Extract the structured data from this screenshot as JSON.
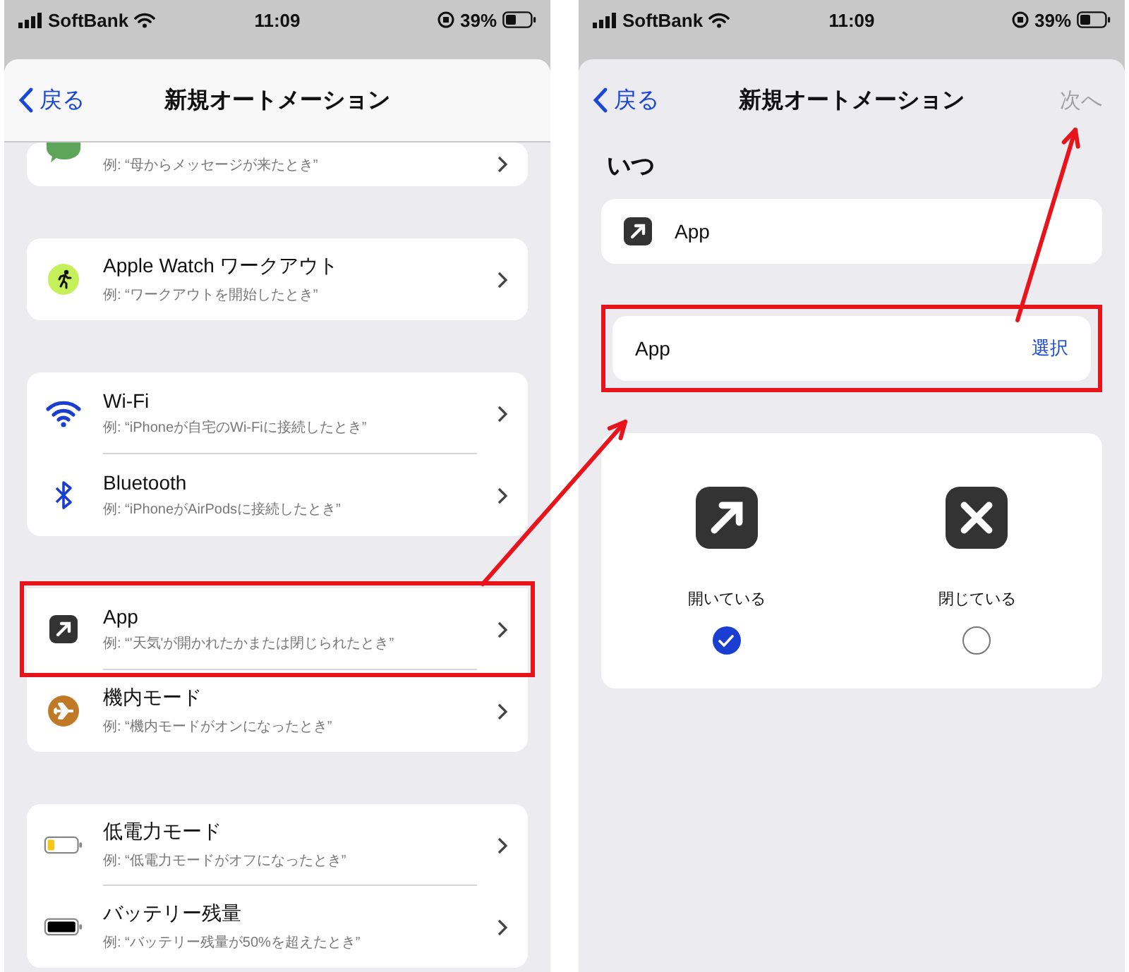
{
  "left_screen": {
    "status_bar": {
      "carrier": "SoftBank",
      "time": "11:09",
      "battery": "39%"
    },
    "nav": {
      "back": "戻る",
      "title": "新規オートメーション"
    },
    "groups": [
      {
        "rows": [
          {
            "kind": "message",
            "subtitle": "例: “母からメッセージが来たとき”",
            "highlighted": false
          }
        ]
      },
      {
        "rows": [
          {
            "kind": "workout",
            "title": "Apple Watch ワークアウト",
            "subtitle": "例: “ワークアウトを開始したとき”",
            "highlighted": false
          }
        ]
      },
      {
        "rows": [
          {
            "kind": "wifi",
            "title": "Wi-Fi",
            "subtitle": "例: “iPhoneが自宅のWi-Fiに接続したとき”",
            "highlighted": false
          },
          {
            "kind": "bluetooth",
            "title": "Bluetooth",
            "subtitle": "例: “iPhoneがAirPodsに接続したとき”",
            "highlighted": false
          }
        ]
      },
      {
        "rows": [
          {
            "kind": "app",
            "title": "App",
            "subtitle": "例: “'天気'が開かれたかまたは閉じられたとき”",
            "highlighted": true
          },
          {
            "kind": "airplane",
            "title": "機内モード",
            "subtitle": "例: “機内モードがオンになったとき”",
            "highlighted": false
          }
        ]
      },
      {
        "rows": [
          {
            "kind": "low_power",
            "title": "低電力モード",
            "subtitle": "例: “低電力モードがオフになったとき”",
            "highlighted": false
          },
          {
            "kind": "battery",
            "title": "バッテリー残量",
            "subtitle": "例: “バッテリー残量が50%を超えたとき”",
            "highlighted": false
          }
        ]
      }
    ]
  },
  "right_screen": {
    "status_bar": {
      "carrier": "SoftBank",
      "time": "11:09",
      "battery": "39%"
    },
    "nav": {
      "back": "戻る",
      "title": "新規オートメーション",
      "next": {
        "label": "次へ",
        "disabled": true
      }
    },
    "heading": "いつ",
    "trigger": {
      "kind": "app",
      "label": "App"
    },
    "picker": {
      "label": "App",
      "action": "選択",
      "highlighted": true
    },
    "options": [
      {
        "kind": "open",
        "label": "開いている",
        "selected": true
      },
      {
        "kind": "closed",
        "label": "閉じている",
        "selected": false
      }
    ]
  }
}
